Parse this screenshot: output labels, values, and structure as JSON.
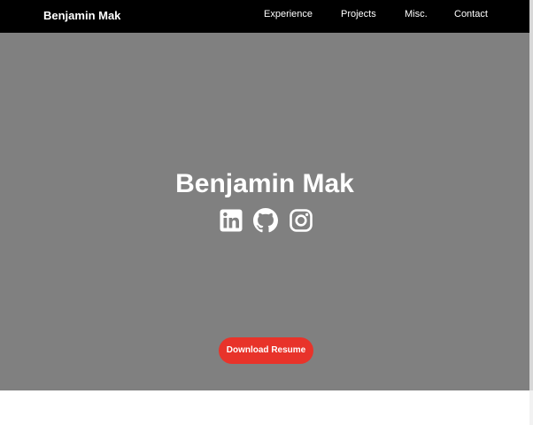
{
  "navbar": {
    "brand": "Benjamin Mak",
    "links": [
      {
        "label": "Experience"
      },
      {
        "label": "Projects"
      },
      {
        "label": "Misc."
      },
      {
        "label": "Contact"
      }
    ]
  },
  "hero": {
    "title": "Benjamin Mak",
    "socials": [
      {
        "icon": "linkedin-icon"
      },
      {
        "icon": "github-icon"
      },
      {
        "icon": "instagram-icon"
      }
    ],
    "resume_button": "Download Resume"
  },
  "colors": {
    "navbar_bg": "#000000",
    "hero_bg": "#808080",
    "button_bg": "#e8332a",
    "text": "#ffffff"
  }
}
